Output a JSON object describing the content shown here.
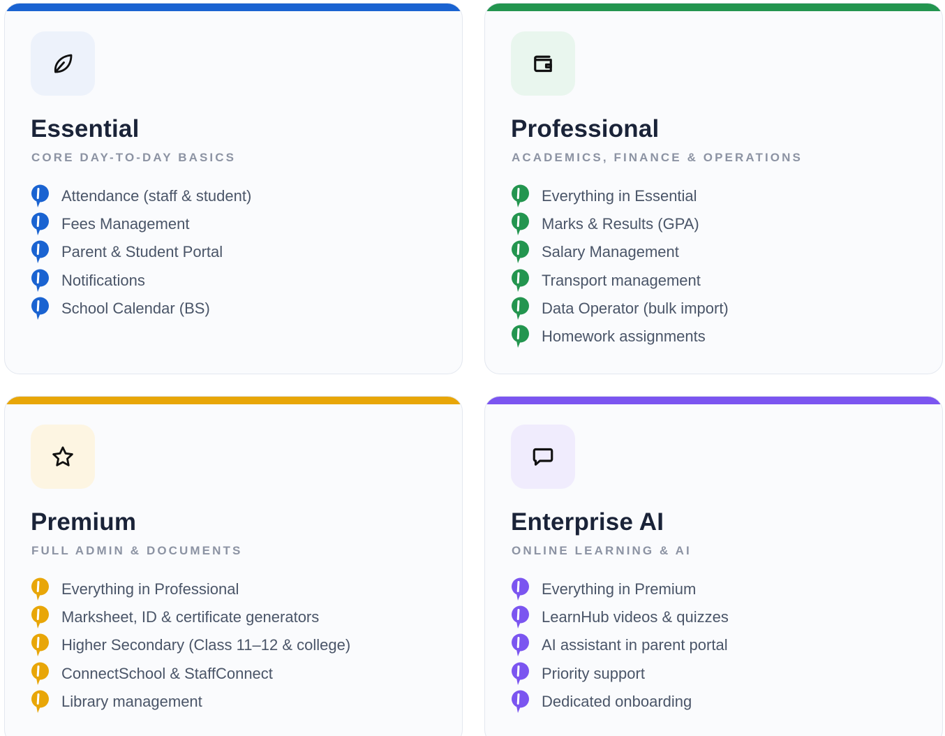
{
  "plans": [
    {
      "title": "Essential",
      "subtitle": "CORE DAY-TO-DAY BASICS",
      "icon": "leaf-icon",
      "accent": "#1a63d1",
      "icon_bg": "#edf2fb",
      "features": [
        "Attendance (staff & student)",
        "Fees Management",
        "Parent & Student Portal",
        "Notifications",
        "School Calendar (BS)"
      ]
    },
    {
      "title": "Professional",
      "subtitle": "ACADEMICS, FINANCE & OPERATIONS",
      "icon": "wallet-icon",
      "accent": "#23954f",
      "icon_bg": "#e9f6ee",
      "features": [
        "Everything in Essential",
        "Marks & Results (GPA)",
        "Salary Management",
        "Transport management",
        "Data Operator (bulk import)",
        "Homework assignments"
      ]
    },
    {
      "title": "Premium",
      "subtitle": "FULL ADMIN & DOCUMENTS",
      "icon": "star-icon",
      "accent": "#e8a608",
      "icon_bg": "#fdf5e2",
      "features": [
        "Everything in Professional",
        "Marksheet, ID & certificate generators",
        "Higher Secondary (Class 11–12 & college)",
        "ConnectSchool & StaffConnect",
        "Library management"
      ]
    },
    {
      "title": "Enterprise AI",
      "subtitle": "ONLINE LEARNING & AI",
      "icon": "chat-bubble-icon",
      "accent": "#7b55f0",
      "icon_bg": "#f0ecfd",
      "features": [
        "Everything in Premium",
        "LearnHub videos & quizzes",
        "AI assistant in parent portal",
        "Priority support",
        "Dedicated onboarding"
      ]
    }
  ]
}
